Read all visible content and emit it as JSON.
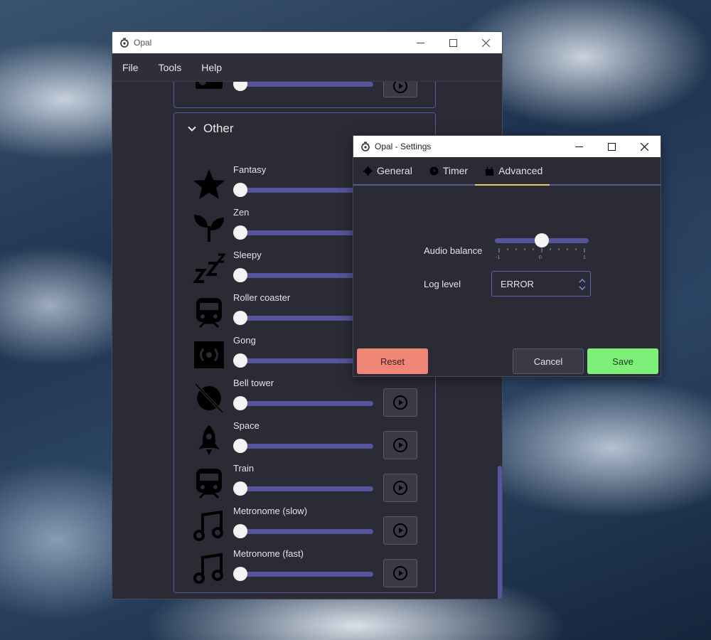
{
  "main_window": {
    "title": "Opal",
    "menu": [
      "File",
      "Tools",
      "Help"
    ],
    "group_title": "Other",
    "sounds": [
      {
        "label": "Fantasy",
        "icon": "star-icon"
      },
      {
        "label": "Zen",
        "icon": "sprout-icon"
      },
      {
        "label": "Sleepy",
        "icon": "sleep-zzz-icon"
      },
      {
        "label": "Roller coaster",
        "icon": "train-icon"
      },
      {
        "label": "Gong",
        "icon": "broadcast-icon"
      },
      {
        "label": "Bell tower",
        "icon": "bell-off-icon"
      },
      {
        "label": "Space",
        "icon": "rocket-icon"
      },
      {
        "label": "Train",
        "icon": "train-icon"
      },
      {
        "label": "Metronome (slow)",
        "icon": "music-note-icon"
      },
      {
        "label": "Metronome (fast)",
        "icon": "music-note-icon"
      }
    ]
  },
  "settings": {
    "title": "Opal - Settings",
    "tabs": [
      {
        "label": "General",
        "icon": "gear-icon"
      },
      {
        "label": "Timer",
        "icon": "clock-icon"
      },
      {
        "label": "Advanced",
        "icon": "robot-icon",
        "active": true
      }
    ],
    "audio_balance": {
      "label": "Audio balance",
      "value": 0,
      "min": -1,
      "max": 1,
      "tick_labels": [
        "-1",
        "0",
        "1"
      ]
    },
    "log_level": {
      "label": "Log level",
      "value": "ERROR"
    },
    "buttons": {
      "reset": "Reset",
      "cancel": "Cancel",
      "save": "Save"
    }
  },
  "colors": {
    "accent": "#56549a",
    "active_tab": "#f0c46b",
    "reset": "#f08676",
    "save": "#7ef07a"
  }
}
